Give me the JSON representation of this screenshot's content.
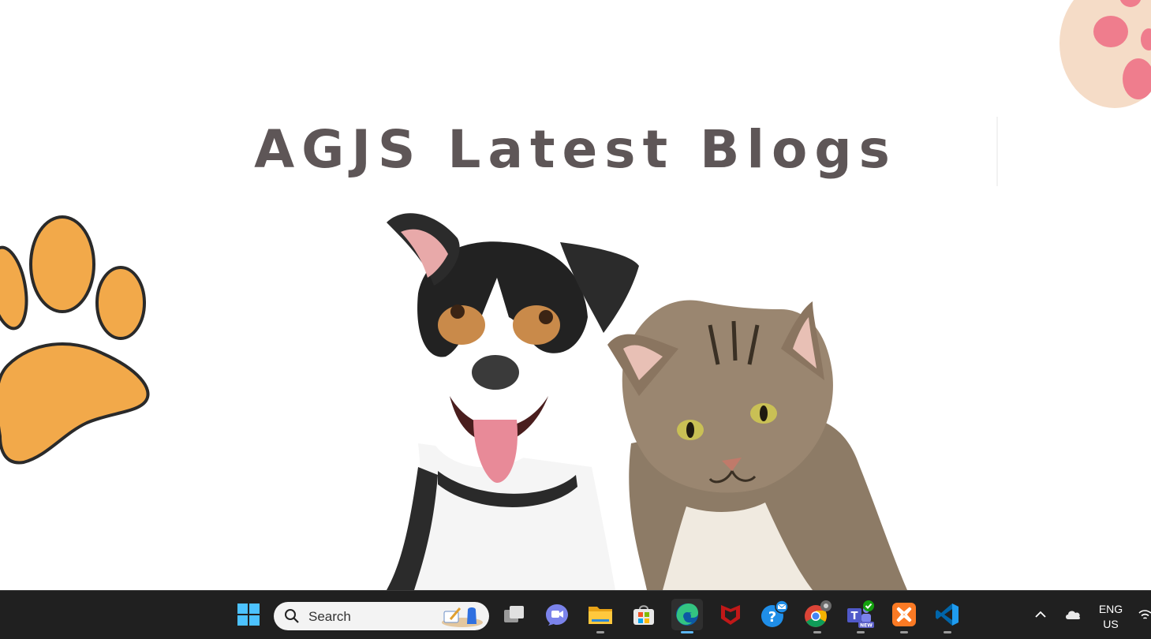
{
  "page": {
    "title": "AGJS Latest Blogs"
  },
  "taskbar": {
    "search_placeholder": "Search",
    "apps": [
      "start",
      "task-view",
      "meet",
      "file-explorer",
      "microsoft-store",
      "edge",
      "mcafee",
      "get-help",
      "chrome",
      "teams",
      "xampp",
      "vscode"
    ],
    "active_app": "edge",
    "tray": {
      "language_line1": "ENG",
      "language_line2": "US"
    }
  },
  "colors": {
    "title": "#5e5657",
    "paw_orange": "#f2a94a",
    "taskbar_bg": "#202020",
    "active_indicator": "#5cb6f2"
  }
}
